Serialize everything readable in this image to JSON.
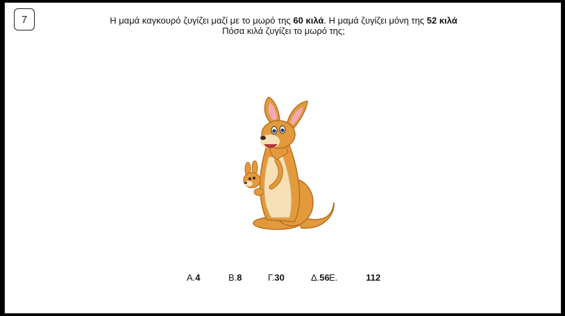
{
  "question_number": "7",
  "question": {
    "line1_pre": "Η μαμά καγκουρό ζυγίζει μαζί με το μωρό της ",
    "line1_bold1": "60 κιλά",
    "line1_mid": ". Η μαμά ζυγίζει μόνη της ",
    "line1_bold2": "52 κιλά",
    "line2": "Πόσα κιλά ζυγίζει το μωρό της;"
  },
  "image": {
    "icon": "kangaroo-with-joey-illustration"
  },
  "answers": [
    {
      "letter": "Α.",
      "value": "4"
    },
    {
      "letter": "Β.",
      "value": "8"
    },
    {
      "letter": "Γ.",
      "value": "30"
    },
    {
      "letter": "Δ.",
      "value": "56"
    },
    {
      "letter": "Ε.",
      "value": "112"
    }
  ]
}
